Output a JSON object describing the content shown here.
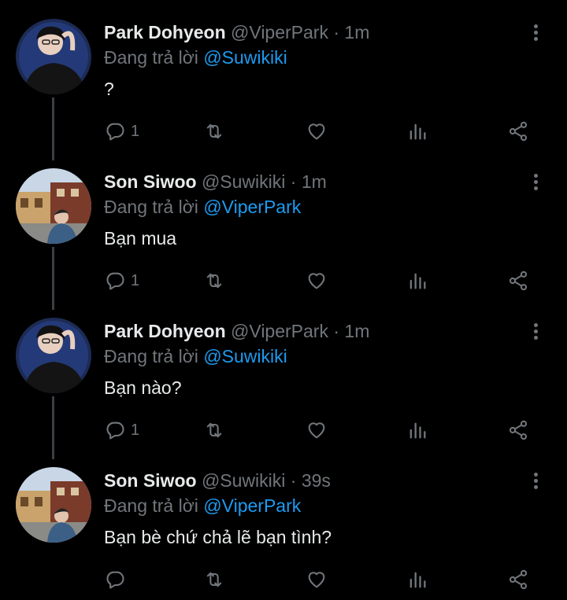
{
  "tweets": [
    {
      "name": "Park Dohyeon",
      "handle": "@ViperPark",
      "dot": "·",
      "time": "1m",
      "reply_prefix": "Đang trả lời",
      "reply_to": "@Suwikiki",
      "text": "?",
      "reply_count": "1",
      "avatar_icon": "avatar-dohyeon"
    },
    {
      "name": "Son Siwoo",
      "handle": "@Suwikiki",
      "dot": "·",
      "time": "1m",
      "reply_prefix": "Đang trả lời",
      "reply_to": "@ViperPark",
      "text": "Bạn mua",
      "reply_count": "1",
      "avatar_icon": "avatar-siwoo"
    },
    {
      "name": "Park Dohyeon",
      "handle": "@ViperPark",
      "dot": "·",
      "time": "1m",
      "reply_prefix": "Đang trả lời",
      "reply_to": "@Suwikiki",
      "text": "Bạn nào?",
      "reply_count": "1",
      "avatar_icon": "avatar-dohyeon"
    },
    {
      "name": "Son Siwoo",
      "handle": "@Suwikiki",
      "dot": "·",
      "time": "39s",
      "reply_prefix": "Đang trả lời",
      "reply_to": "@ViperPark",
      "text": "Bạn bè chứ chả lẽ bạn tình?",
      "reply_count": "",
      "avatar_icon": "avatar-siwoo"
    }
  ],
  "colors": {
    "background": "#000000",
    "text": "#e7e9ea",
    "muted": "#71767b",
    "accent": "#1d9bf0"
  },
  "icons": [
    "more-icon",
    "reply-icon",
    "retweet-icon",
    "like-icon",
    "views-icon",
    "share-icon"
  ]
}
